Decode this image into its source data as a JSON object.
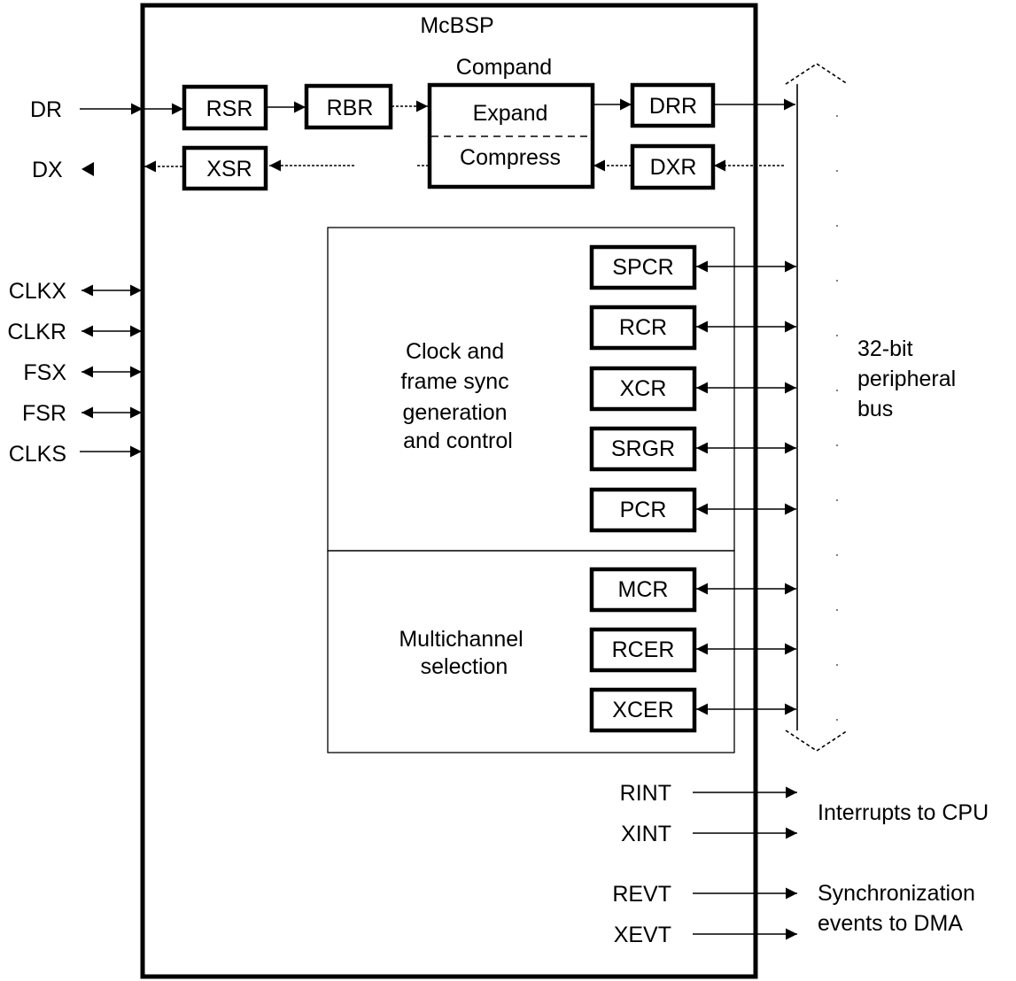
{
  "diagram": {
    "title": "McBSP",
    "compand": {
      "label": "Compand",
      "expand": "Expand",
      "compress": "Compress"
    },
    "registers_data": [
      "RSR",
      "RBR",
      "DRR",
      "XSR",
      "DXR"
    ],
    "pins": {
      "DR": "DR",
      "DX": "DX",
      "CLKX": "CLKX",
      "CLKR": "CLKR",
      "FSX": "FSX",
      "FSR": "FSR",
      "CLKS": "CLKS"
    },
    "clock_block": {
      "label_lines": [
        "Clock and",
        "frame sync",
        "generation",
        "and control"
      ],
      "registers": [
        "SPCR",
        "RCR",
        "XCR",
        "SRGR",
        "PCR"
      ]
    },
    "multichannel_block": {
      "label_lines": [
        "Multichannel",
        "selection"
      ],
      "registers": [
        "MCR",
        "RCER",
        "XCER"
      ]
    },
    "bus": {
      "label_lines": [
        "32-bit",
        "peripheral",
        "bus"
      ]
    },
    "outputs": {
      "interrupts": [
        "RINT",
        "XINT"
      ],
      "interrupts_label": "Interrupts to CPU",
      "events": [
        "REVT",
        "XEVT"
      ],
      "events_label_lines": [
        "Synchronization",
        "events to DMA"
      ]
    }
  }
}
